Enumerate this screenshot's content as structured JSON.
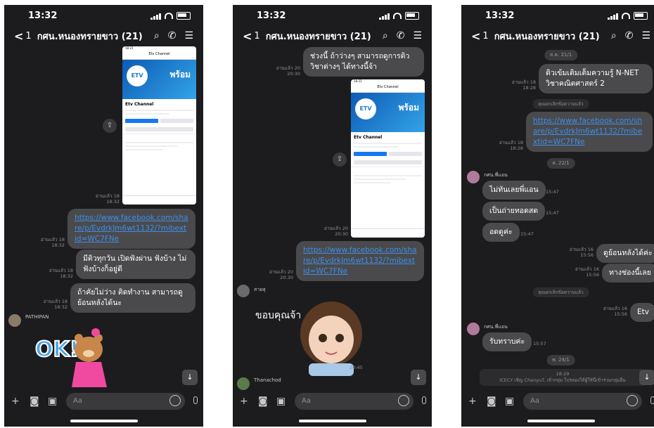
{
  "phones": [
    {
      "time": "13:32",
      "back_count": "1",
      "title": "กศน.หนองทรายขาว (21)",
      "share_icon": "share-icon",
      "meta_img": "อ่านแล้ว 18\n18:32",
      "link_text": "https://www.facebook.com/share/p/EvdrkJm6wt1132/?mibextid=WC7FNe",
      "meta_link": "อ่านแล้ว 18\n18:32",
      "msg1": "มีติวทุกวัน เปิดฟังผ่าน ฟังบ้าง ไม่ฟังบ้างก็อยู่ดี",
      "meta_msg1": "อ่านแล้ว 18\n18:32",
      "msg2": "ถ้าคัยไม่ว่าง ติดทำงาน สามารถดูย้อนหลังได้นะ",
      "meta_msg2": "อ่านแล้ว 18\n18:32",
      "sender": "PATHIPAN",
      "sticker_text": "OK!",
      "input_placeholder": "Aa"
    },
    {
      "time": "13:32",
      "back_count": "1",
      "title": "กศน.หนองทรายขาว (21)",
      "msg1": "ช่วงนี้ ถ้าว่างๆ สามารถดูการติววิชาต่างๆ ได้ทางนี้จ้า",
      "meta_msg1": "อ่านแล้ว 20\n20:30",
      "meta_img": "อ่านแล้ว 20\n20:30",
      "link_text": "https://www.facebook.com/share/p/EvdrkJm6wt1132/?mibextid=WC7FNe",
      "meta_link": "อ่านแล้ว 20\n20:30",
      "sender1": "สายสุ",
      "sticker_text": "ขอบคุณจ้า",
      "sticker_time": "20:45",
      "sender2": "Thanachod",
      "input_placeholder": "Aa"
    },
    {
      "time": "13:32",
      "back_count": "1",
      "title": "กศน.หนองทรายขาว (21)",
      "date1": "ส.ค. 21/1",
      "msg1": "ติวเข้มเติมเต็มความรู้ N-NET วิชาคณิตศาสตร์ 2",
      "meta_msg1": "อ่านแล้ว 18\n18:28",
      "note1": "คุณยกเลิกข้อความแล้ว",
      "link_text": "https://www.facebook.com/share/p/EvdrkJm6wt1132/?mibextid=WC7FNe",
      "meta_link": "อ่านแล้ว 18\n18:28",
      "date2": "ส. 22/1",
      "sender": "กศน.พี่แอน",
      "r1": "ไม่ทันเลยพี่แอน",
      "r1t": "15:47",
      "r2": "เป็นถ่ายทอดสด",
      "r2t": "15:47",
      "r3": "อดดูค่ะ",
      "r3t": "15:47",
      "s1": "ดูย้อนหลังได้ค่ะ",
      "s1m": "อ่านแล้ว 16\n15:56",
      "s2": "ทางช่องนี้เลย",
      "s2m": "อ่านแล้ว 16\n15:56",
      "note2": "คุณยกเลิกข้อความแล้ว",
      "s3": "Etv",
      "s3m": "อ่านแล้ว 16\n15:56",
      "sender_b": "กศน.พี่แอน",
      "r4": "รับทราบค่ะ",
      "r4t": "15:57",
      "date3": "พ. 24/1",
      "bottom_time": "18:29",
      "bottom_note": "ICECY เชิญ ChanyuT. เข้ากลุ่ม ไปรลองให้ผู้ใช้นี้เข้าร่วมกลุ่มอื่น",
      "input_placeholder": "Aa"
    }
  ],
  "fb_shot": {
    "page_name": "Etv Channel",
    "nav_title": "Etv Channel",
    "cover_logo": "ETV",
    "cover_text": "พร้อม"
  }
}
